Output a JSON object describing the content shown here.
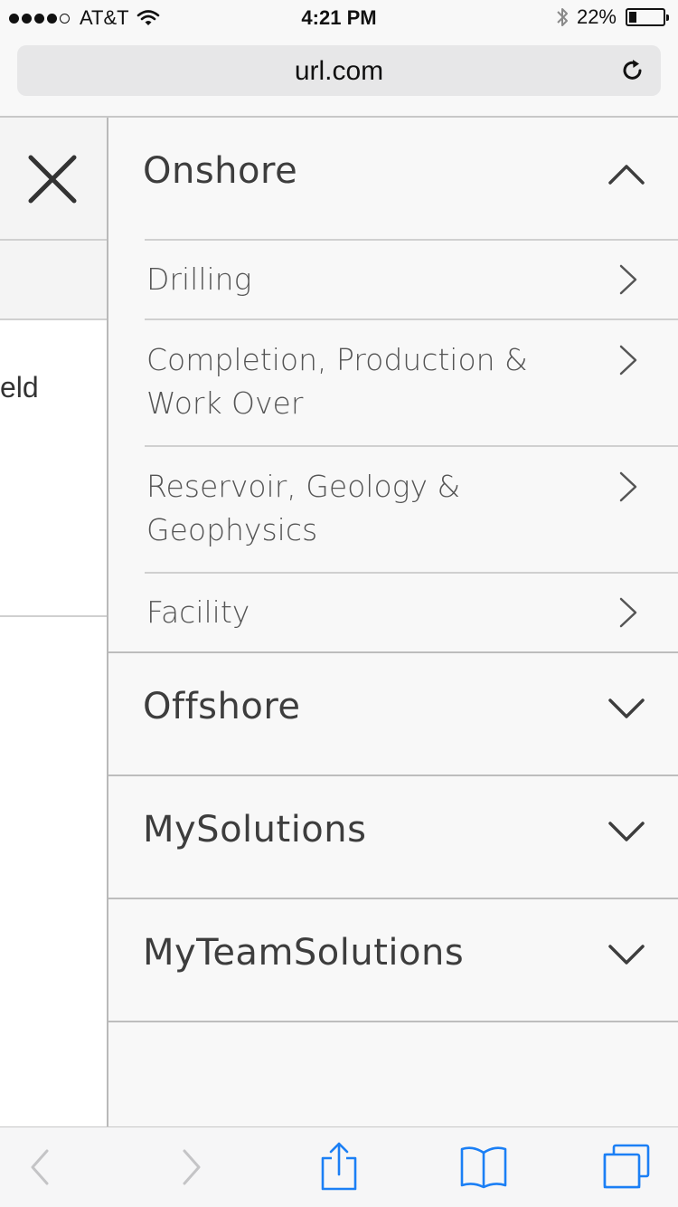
{
  "status_bar": {
    "carrier": "AT&T",
    "time": "4:21 PM",
    "battery_percent": "22%",
    "battery_level": 0.22,
    "signal_bars": 4
  },
  "browser": {
    "url": "url.com"
  },
  "background_page": {
    "partial_text": "eld"
  },
  "menu": {
    "sections": [
      {
        "label": "Onshore",
        "expanded": true,
        "items": [
          {
            "label": "Drilling"
          },
          {
            "label": "Completion, Production & Work Over"
          },
          {
            "label": "Reservoir, Geology & Geophysics"
          },
          {
            "label": "Facility"
          }
        ]
      },
      {
        "label": "Offshore",
        "expanded": false
      },
      {
        "label": "MySolutions",
        "expanded": false
      },
      {
        "label": "MyTeamSolutions",
        "expanded": false
      }
    ]
  },
  "colors": {
    "ios_blue": "#1b7ff5",
    "disabled_grey": "#c4c4c6",
    "menu_text": "#3d3d3d"
  }
}
